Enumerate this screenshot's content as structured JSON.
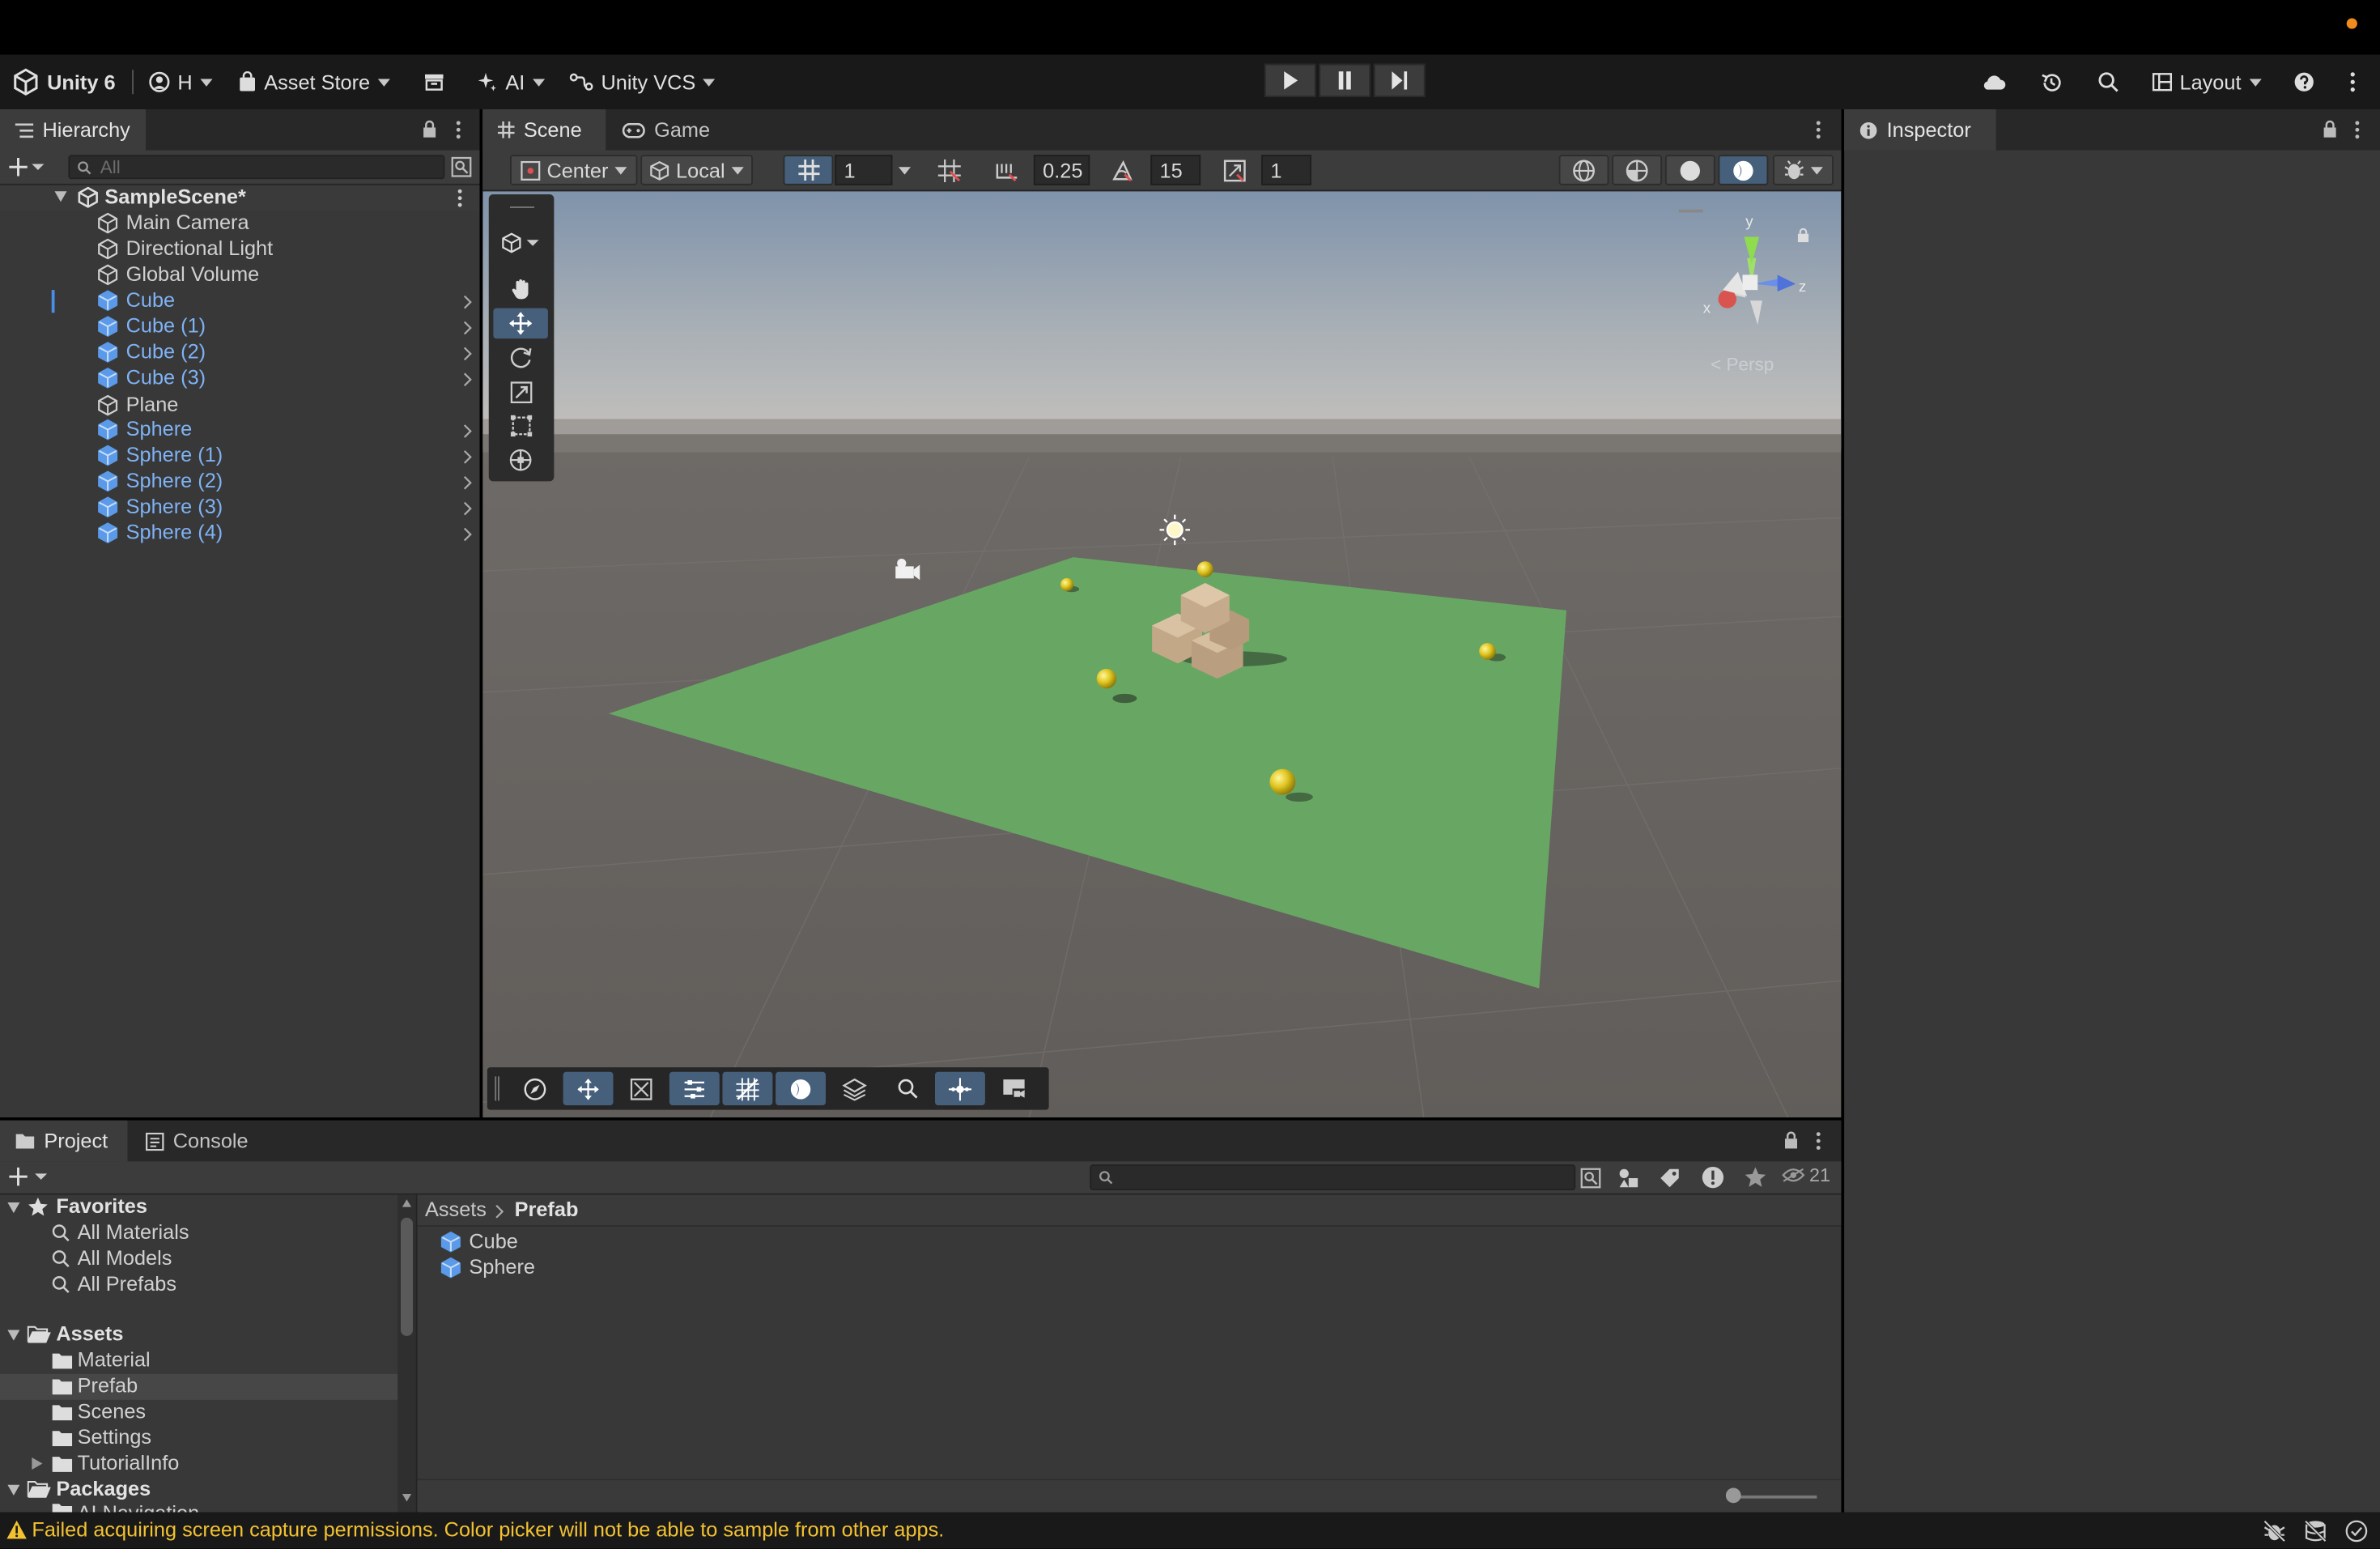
{
  "toolbar": {
    "app_name": "Unity 6",
    "account": "H",
    "asset_store": "Asset Store",
    "ai": "AI",
    "vcs": "Unity VCS",
    "layout": "Layout"
  },
  "hierarchy": {
    "tab": "Hierarchy",
    "search_placeholder": "All",
    "scene": "SampleScene*",
    "items": [
      {
        "label": "Main Camera"
      },
      {
        "label": "Directional Light"
      },
      {
        "label": "Global Volume"
      },
      {
        "label": "Cube"
      },
      {
        "label": "Cube (1)"
      },
      {
        "label": "Cube (2)"
      },
      {
        "label": "Cube (3)"
      },
      {
        "label": "Plane"
      },
      {
        "label": "Sphere"
      },
      {
        "label": "Sphere (1)"
      },
      {
        "label": "Sphere (2)"
      },
      {
        "label": "Sphere (3)"
      },
      {
        "label": "Sphere (4)"
      }
    ]
  },
  "scene_view": {
    "tabs": [
      {
        "label": "Scene"
      },
      {
        "label": "Game"
      }
    ],
    "pivot": "Center",
    "space": "Local",
    "grid_size": "1",
    "snap_move": "0.25",
    "snap_rotate": "15",
    "snap_scale": "1",
    "gizmo_axes": {
      "x": "x",
      "y": "y",
      "z": "z"
    },
    "gizmo_label": "< Persp"
  },
  "inspector": {
    "tab": "Inspector"
  },
  "project": {
    "tabs": [
      {
        "label": "Project"
      },
      {
        "label": "Console"
      }
    ],
    "hidden_count": "21",
    "favorites": {
      "title": "Favorites",
      "items": [
        {
          "label": "All Materials"
        },
        {
          "label": "All Models"
        },
        {
          "label": "All Prefabs"
        }
      ]
    },
    "assets": {
      "title": "Assets",
      "items": [
        {
          "label": "Material"
        },
        {
          "label": "Prefab"
        },
        {
          "label": "Scenes"
        },
        {
          "label": "Settings"
        },
        {
          "label": "TutorialInfo"
        }
      ]
    },
    "packages": {
      "title": "Packages",
      "first_child": "AI Navigation"
    },
    "breadcrumb": {
      "root": "Assets",
      "current": "Prefab"
    },
    "files": [
      {
        "label": "Cube"
      },
      {
        "label": "Sphere"
      }
    ]
  },
  "status": {
    "message": "Failed acquiring screen capture permissions. Color picker will not be able to sample from other apps."
  }
}
